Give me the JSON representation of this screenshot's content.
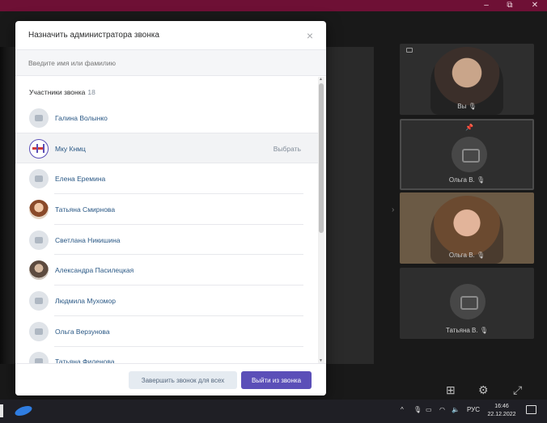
{
  "window_controls": {
    "minimize": "–",
    "restore": "⧉",
    "close": "✕"
  },
  "dialog": {
    "title": "Назначить администратора звонка",
    "close_symbol": "×",
    "search_placeholder": "Введите имя или фамилию",
    "section_label": "Участники звонка",
    "section_count": "18",
    "choose_label": "Выбрать",
    "participants": [
      {
        "name": "Галина Волынко",
        "avatar": "placeholder"
      },
      {
        "name": "Мку Кнмц",
        "avatar": "logo"
      },
      {
        "name": "Елена Еремина",
        "avatar": "placeholder"
      },
      {
        "name": "Татьяна Смирнова",
        "avatar": "photo1"
      },
      {
        "name": "Светлана Никишина",
        "avatar": "placeholder"
      },
      {
        "name": "Александра Пасилецкая",
        "avatar": "photo2"
      },
      {
        "name": "Людмила Мухомор",
        "avatar": "placeholder"
      },
      {
        "name": "Ольга Верзунова",
        "avatar": "placeholder"
      },
      {
        "name": "Татьяна Филенова",
        "avatar": "placeholder"
      }
    ],
    "hovered_index": 1,
    "end_for_all_label": "Завершить звонок для всех",
    "leave_label": "Выйти из звонка"
  },
  "tiles": [
    {
      "name": "Вы",
      "kind": "video"
    },
    {
      "name": "Ольга В.",
      "kind": "camera-off",
      "active": true
    },
    {
      "name": "Ольга В.",
      "kind": "video"
    },
    {
      "name": "Татьяна В.",
      "kind": "camera-off"
    }
  ],
  "muted_symbol": "🎙̸",
  "taskbar": {
    "tray_chevron": "^",
    "lang": "РУС",
    "time": "16:46",
    "date": "22.12.2022"
  },
  "colors": {
    "accent": "#5b4fb8",
    "titlebar": "#6e1035",
    "link": "#2a5885"
  }
}
